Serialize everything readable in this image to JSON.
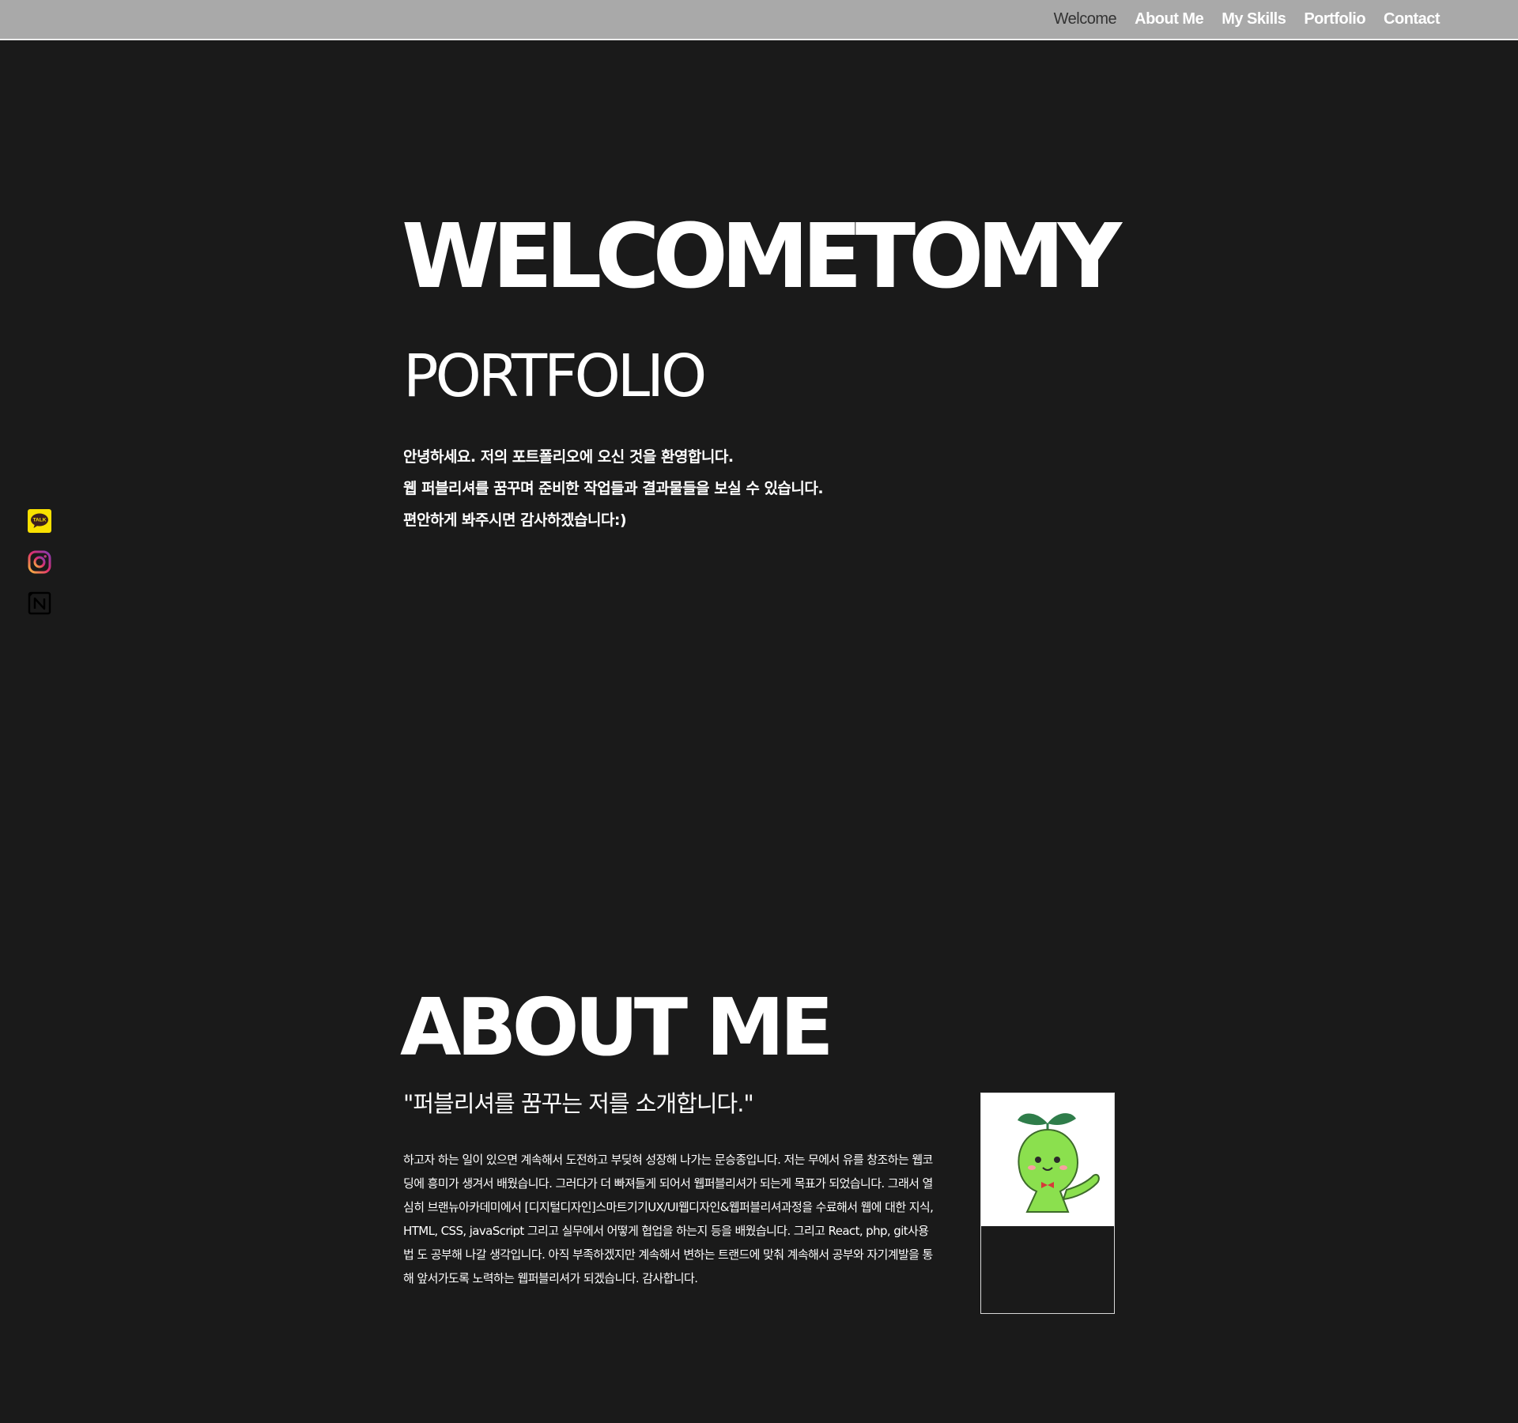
{
  "nav": {
    "items": [
      {
        "label": "Welcome",
        "active": true
      },
      {
        "label": "About Me",
        "active": false
      },
      {
        "label": "My Skills",
        "active": false
      },
      {
        "label": "Portfolio",
        "active": false
      },
      {
        "label": "Contact",
        "active": false
      }
    ]
  },
  "social": {
    "icons": [
      "kakaotalk-icon",
      "instagram-icon",
      "notion-icon"
    ],
    "kakao_badge": "TALK",
    "colors": {
      "kakao": "#f9e000",
      "instagram_start": "#f7b93e",
      "instagram_mid": "#e1306c",
      "instagram_end": "#833ab4",
      "notion": "#000000"
    }
  },
  "hero": {
    "title": "WELCOMETOMY",
    "subtitle": "PORTFOLIO",
    "lines": [
      "안녕하세요. 저의 포트폴리오에 오신 것을 환영합니다.",
      "웹 퍼블리셔를 꿈꾸며 준비한 작업들과 결과물들을 보실 수 있습니다.",
      "편안하게 봐주시면 감사하겠습니다:)"
    ]
  },
  "about": {
    "title": "ABOUT ME",
    "quote": "\"퍼블리셔를 꿈꾸는 저를 소개합니다.\"",
    "body": "하고자 하는 일이 있으면 계속해서 도전하고 부딪혀 성장해 나가는 문승종입니다. 저는 무에서 유를 창조하는 웹코딩에 흥미가 생겨서 배웠습니다. 그러다가 더 빠져들게 되어서 웹퍼블리셔가 되는게 목표가 되었습니다. 그래서 열심히 브랜뉴아카데미에서 [디지털디자인]스마트기기UX/UI웹디자인&웹퍼블리셔과정을 수료해서 웹에 대한 지식, HTML, CSS, javaScript 그리고 실무에서 어떻게 협업을 하는지 등을 배웠습니다. 그리고 React, php, git사용법 도 공부해 나갈 생각입니다. 아직 부족하겠지만 계속해서 변하는 트랜드에 맞춰 계속해서 공부와 자기계발을 통해 앞서가도록 노력하는 웹퍼블리셔가 되겠습니다. 감사합니다.",
    "profile_icon": "sprout-character-icon"
  },
  "colors": {
    "page_bg": "#1a1a1a",
    "nav_bg": "#a9a9a9",
    "text": "#ffffff",
    "nav_active": "#333333",
    "character_green": "#8be04e"
  }
}
